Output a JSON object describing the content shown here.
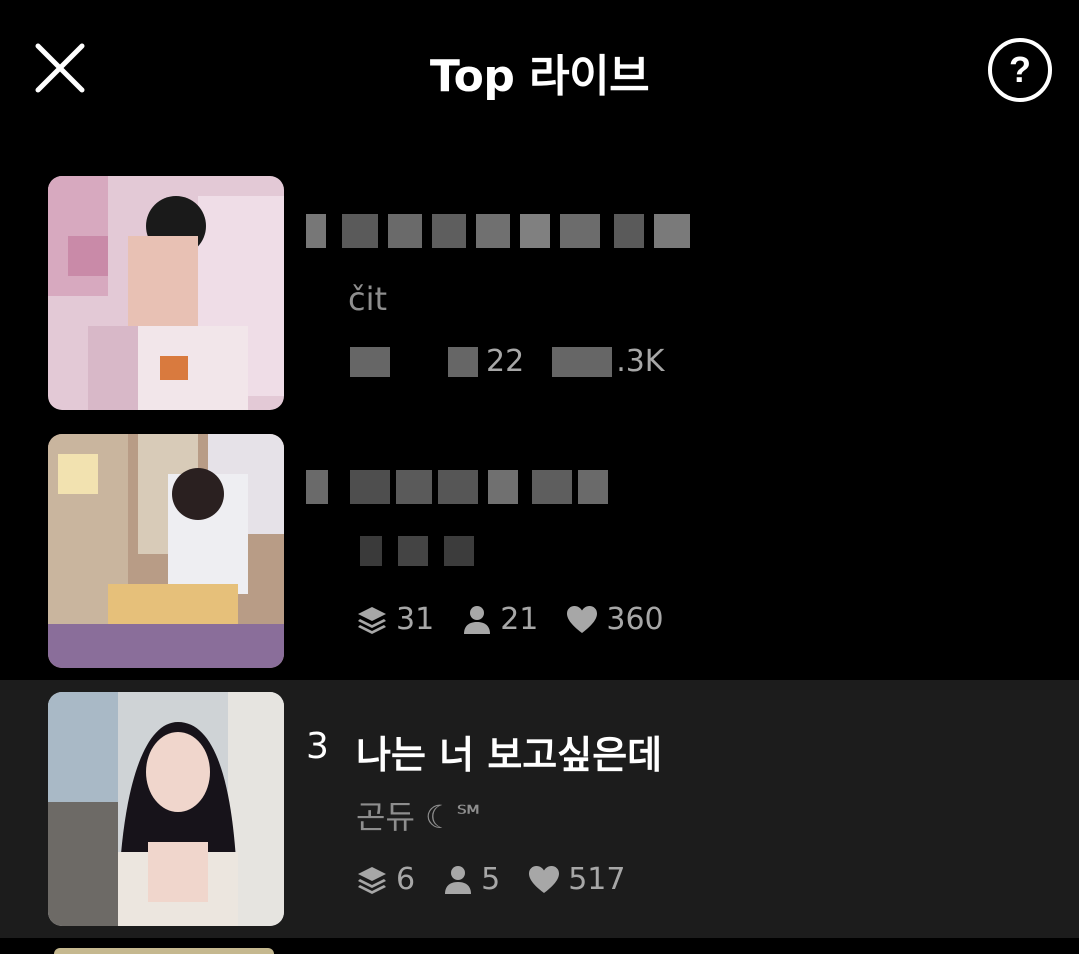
{
  "header": {
    "title": "Top 라이브",
    "close_icon": "close-icon",
    "help_icon": "help-icon"
  },
  "rows": [
    {
      "rank": "",
      "name": "",
      "host": "čit",
      "rooms": "",
      "viewers": "22",
      "likes": ".3K",
      "highlighted": false
    },
    {
      "rank": "",
      "name": "",
      "host": "",
      "rooms": "31",
      "viewers": "21",
      "likes": "360",
      "highlighted": false
    },
    {
      "rank": "3",
      "name": "나는 너 보고싶은데",
      "host": "곤듀 ☾℠",
      "rooms": "6",
      "viewers": "5",
      "likes": "517",
      "highlighted": true
    }
  ],
  "icons": {
    "rooms": "layers-icon",
    "viewers": "person-icon",
    "likes": "heart-icon"
  },
  "colors": {
    "background": "#000000",
    "highlight_row": "#1c1c1c",
    "secondary_text": "#8e8e8e"
  }
}
